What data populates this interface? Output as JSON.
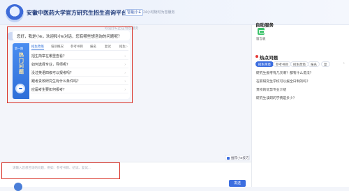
{
  "header": {
    "title": "安徽中医药大学官方研究生招生咨询平台",
    "brand_tag": "智能小E",
    "brand_sub": "24小时随时为您服务"
  },
  "chat": {
    "hint": "欢迎小E正在为您服务",
    "greeting": "您好，我是小E，欢迎和小E对话，您有哪些想咨询的问题呢？",
    "banner_top": "第一期",
    "banner_text": "热门问题",
    "tabs": [
      "招生政策",
      "培训概况",
      "参考书目",
      "报名",
      "复试",
      "招生"
    ],
    "questions": [
      "招生简章在哪里查看？",
      "如何选择专业，导师呢？",
      "没过英语四级可以报考吗？",
      "跟考贵校研究生有什么条件吗？",
      "应届考生要如何报考？"
    ],
    "feedback_label": "推荐小E技巧",
    "input_placeholder": "请输入您想咨询的问题，例如：参考书目、初试、复试...",
    "send_label": "发送"
  },
  "sidebar": {
    "service_title": "自助服务",
    "service_item": "留言板",
    "hot_title": "热点问题",
    "chips": [
      "招生简章",
      "参考书目",
      "招生政策",
      "报名",
      "复"
    ],
    "hot_questions": [
      "研究生报考有几天啊？都有什么说法？",
      "在职研究生学校可以报全日制的吗？",
      "贵校的优势专业介绍",
      "研究生读研的学费是多少？"
    ]
  }
}
